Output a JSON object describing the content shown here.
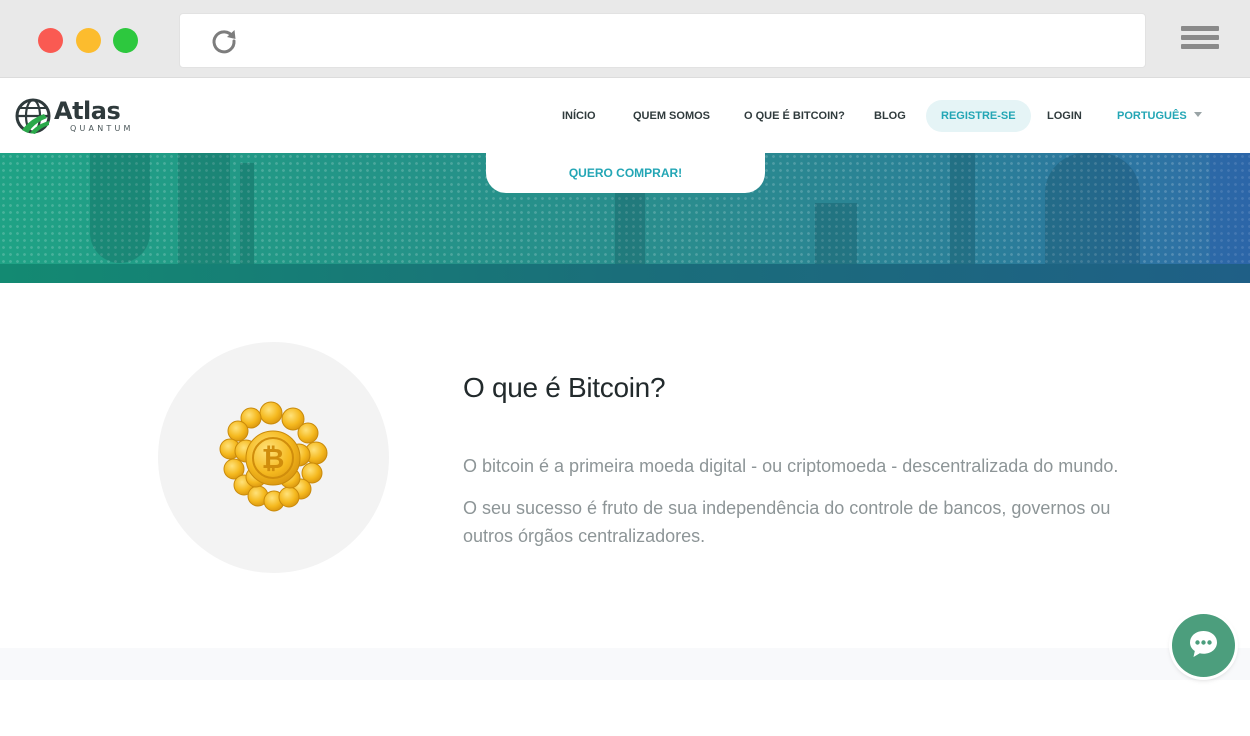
{
  "browser": {
    "icons": {
      "reload": "reload-icon",
      "menu": "hamburger-menu-icon"
    },
    "colors": {
      "close": "#fa5a52",
      "minimize": "#fcbc2e",
      "maximize": "#2dc83e"
    }
  },
  "header": {
    "logo": {
      "name": "Atlas",
      "subtitle": "QUANTUM"
    },
    "nav": {
      "inicio": "INÍCIO",
      "quem_somos": "QUEM SOMOS",
      "o_que_e_bitcoin": "O QUE É BITCOIN?",
      "blog": "BLOG",
      "registre_se": "REGISTRE-SE",
      "login": "LOGIN",
      "language": "PORTUGUÊS"
    }
  },
  "hero": {
    "cta_label": "QUERO COMPRAR!"
  },
  "content": {
    "title": "O que é Bitcoin?",
    "paragraphs": [
      "O bitcoin é a primeira moeda digital - ou criptomoeda - descentralizada do mundo.",
      "O seu sucesso é fruto de sua independência do controle de bancos, governos ou outros órgãos centralizadores."
    ],
    "image_icon": "bitcoin-coins-icon"
  },
  "chat": {
    "icon": "chat-bubble-icon"
  },
  "colors": {
    "accent": "#23a6b5",
    "brand_green": "#1fa285",
    "chat": "#4c9e7d",
    "text_dark": "#222a2c",
    "text_muted": "#8d9597"
  }
}
